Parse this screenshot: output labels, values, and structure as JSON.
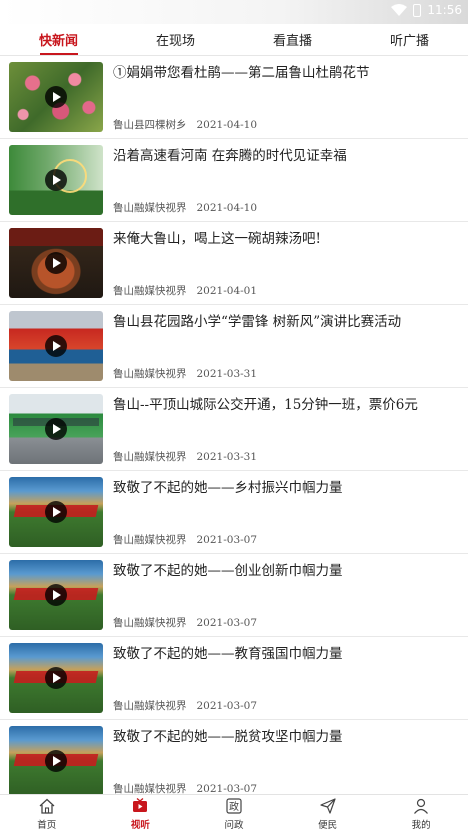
{
  "status_bar": {
    "time": "11:56"
  },
  "tabs": [
    {
      "label": "快新闻",
      "active": true
    },
    {
      "label": "在现场",
      "active": false
    },
    {
      "label": "看直播",
      "active": false
    },
    {
      "label": "听广播",
      "active": false
    }
  ],
  "news": [
    {
      "title": "①娟娟带您看杜鹃——第二届鲁山杜鹃花节",
      "source": "鲁山县四棵树乡",
      "date": "2021-04-10",
      "thumb": "flower"
    },
    {
      "title": "沿着高速看河南 在奔腾的时代见证幸福",
      "source": "鲁山融媒快视界",
      "date": "2021-04-10",
      "thumb": "highway"
    },
    {
      "title": "来俺大鲁山，喝上这一碗胡辣汤吧!",
      "source": "鲁山融媒快视界",
      "date": "2021-04-01",
      "thumb": "soup"
    },
    {
      "title": "鲁山县花园路小学“学雷锋 树新风”演讲比赛活动",
      "source": "鲁山融媒快视界",
      "date": "2021-03-31",
      "thumb": "stage"
    },
    {
      "title": "鲁山--平顶山城际公交开通，15分钟一班，票价6元",
      "source": "鲁山融媒快视界",
      "date": "2021-03-31",
      "thumb": "bus"
    },
    {
      "title": "致敬了不起的她——乡村振兴巾帼力量",
      "source": "鲁山融媒快视界",
      "date": "2021-03-07",
      "thumb": "field"
    },
    {
      "title": "致敬了不起的她——创业创新巾帼力量",
      "source": "鲁山融媒快视界",
      "date": "2021-03-07",
      "thumb": "field"
    },
    {
      "title": "致敬了不起的她——教育强国巾帼力量",
      "source": "鲁山融媒快视界",
      "date": "2021-03-07",
      "thumb": "field"
    },
    {
      "title": "致敬了不起的她——脱贫攻坚巾帼力量",
      "source": "鲁山融媒快视界",
      "date": "2021-03-07",
      "thumb": "field"
    }
  ],
  "bottom_nav": [
    {
      "label": "首页",
      "icon": "home-icon",
      "active": false
    },
    {
      "label": "视听",
      "icon": "video-icon",
      "active": true
    },
    {
      "label": "问政",
      "icon": "politics-icon",
      "active": false
    },
    {
      "label": "便民",
      "icon": "send-icon",
      "active": false
    },
    {
      "label": "我的",
      "icon": "user-icon",
      "active": false
    }
  ],
  "colors": {
    "accent": "#c8161d",
    "divider": "#e8e8e8"
  }
}
